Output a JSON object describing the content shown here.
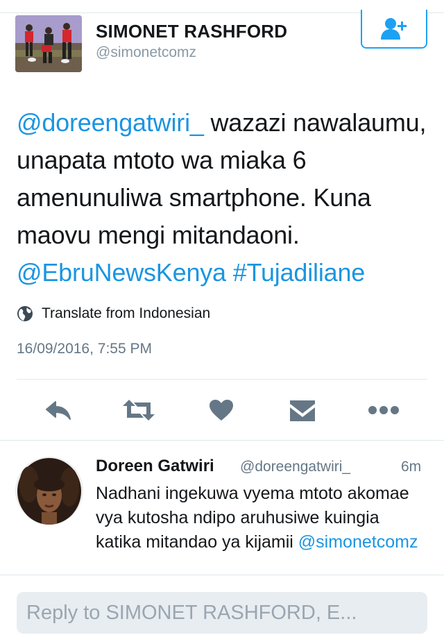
{
  "tweet": {
    "author_name": "SIMONET RASHFORD",
    "author_handle": "@simonetcomz",
    "mention": "@doreengatwiri_",
    "body_text": " wazazi nawalaumu, unapata mtoto wa miaka 6 amenunuliwa smartphone. Kuna maovu mengi mitandaoni. ",
    "mention_2": "@EbruNewsKenya",
    "hashtag": "#Tujadiliane",
    "translate_label": "Translate from Indonesian",
    "timestamp": "16/09/2016, 7:55 PM"
  },
  "actions": {
    "icons": [
      "reply-icon",
      "retweet-icon",
      "like-icon",
      "direct-message-icon",
      "more-icon"
    ]
  },
  "reply": {
    "author_name": "Doreen Gatwiri",
    "author_handle": "@doreengatwiri_",
    "time_ago": "6m",
    "text": "Nadhani ingekuwa vyema mtoto akomae vya kutosha ndipo aruhusiwe kuingia katika mitandao ya kijamii ",
    "mention": "@simonetcomz"
  },
  "composer": {
    "placeholder": "Reply to SIMONET RASHFORD, E..."
  },
  "colors": {
    "link": "#1b95e0",
    "action_icon": "#657786",
    "follow_border": "#1da1f2"
  }
}
